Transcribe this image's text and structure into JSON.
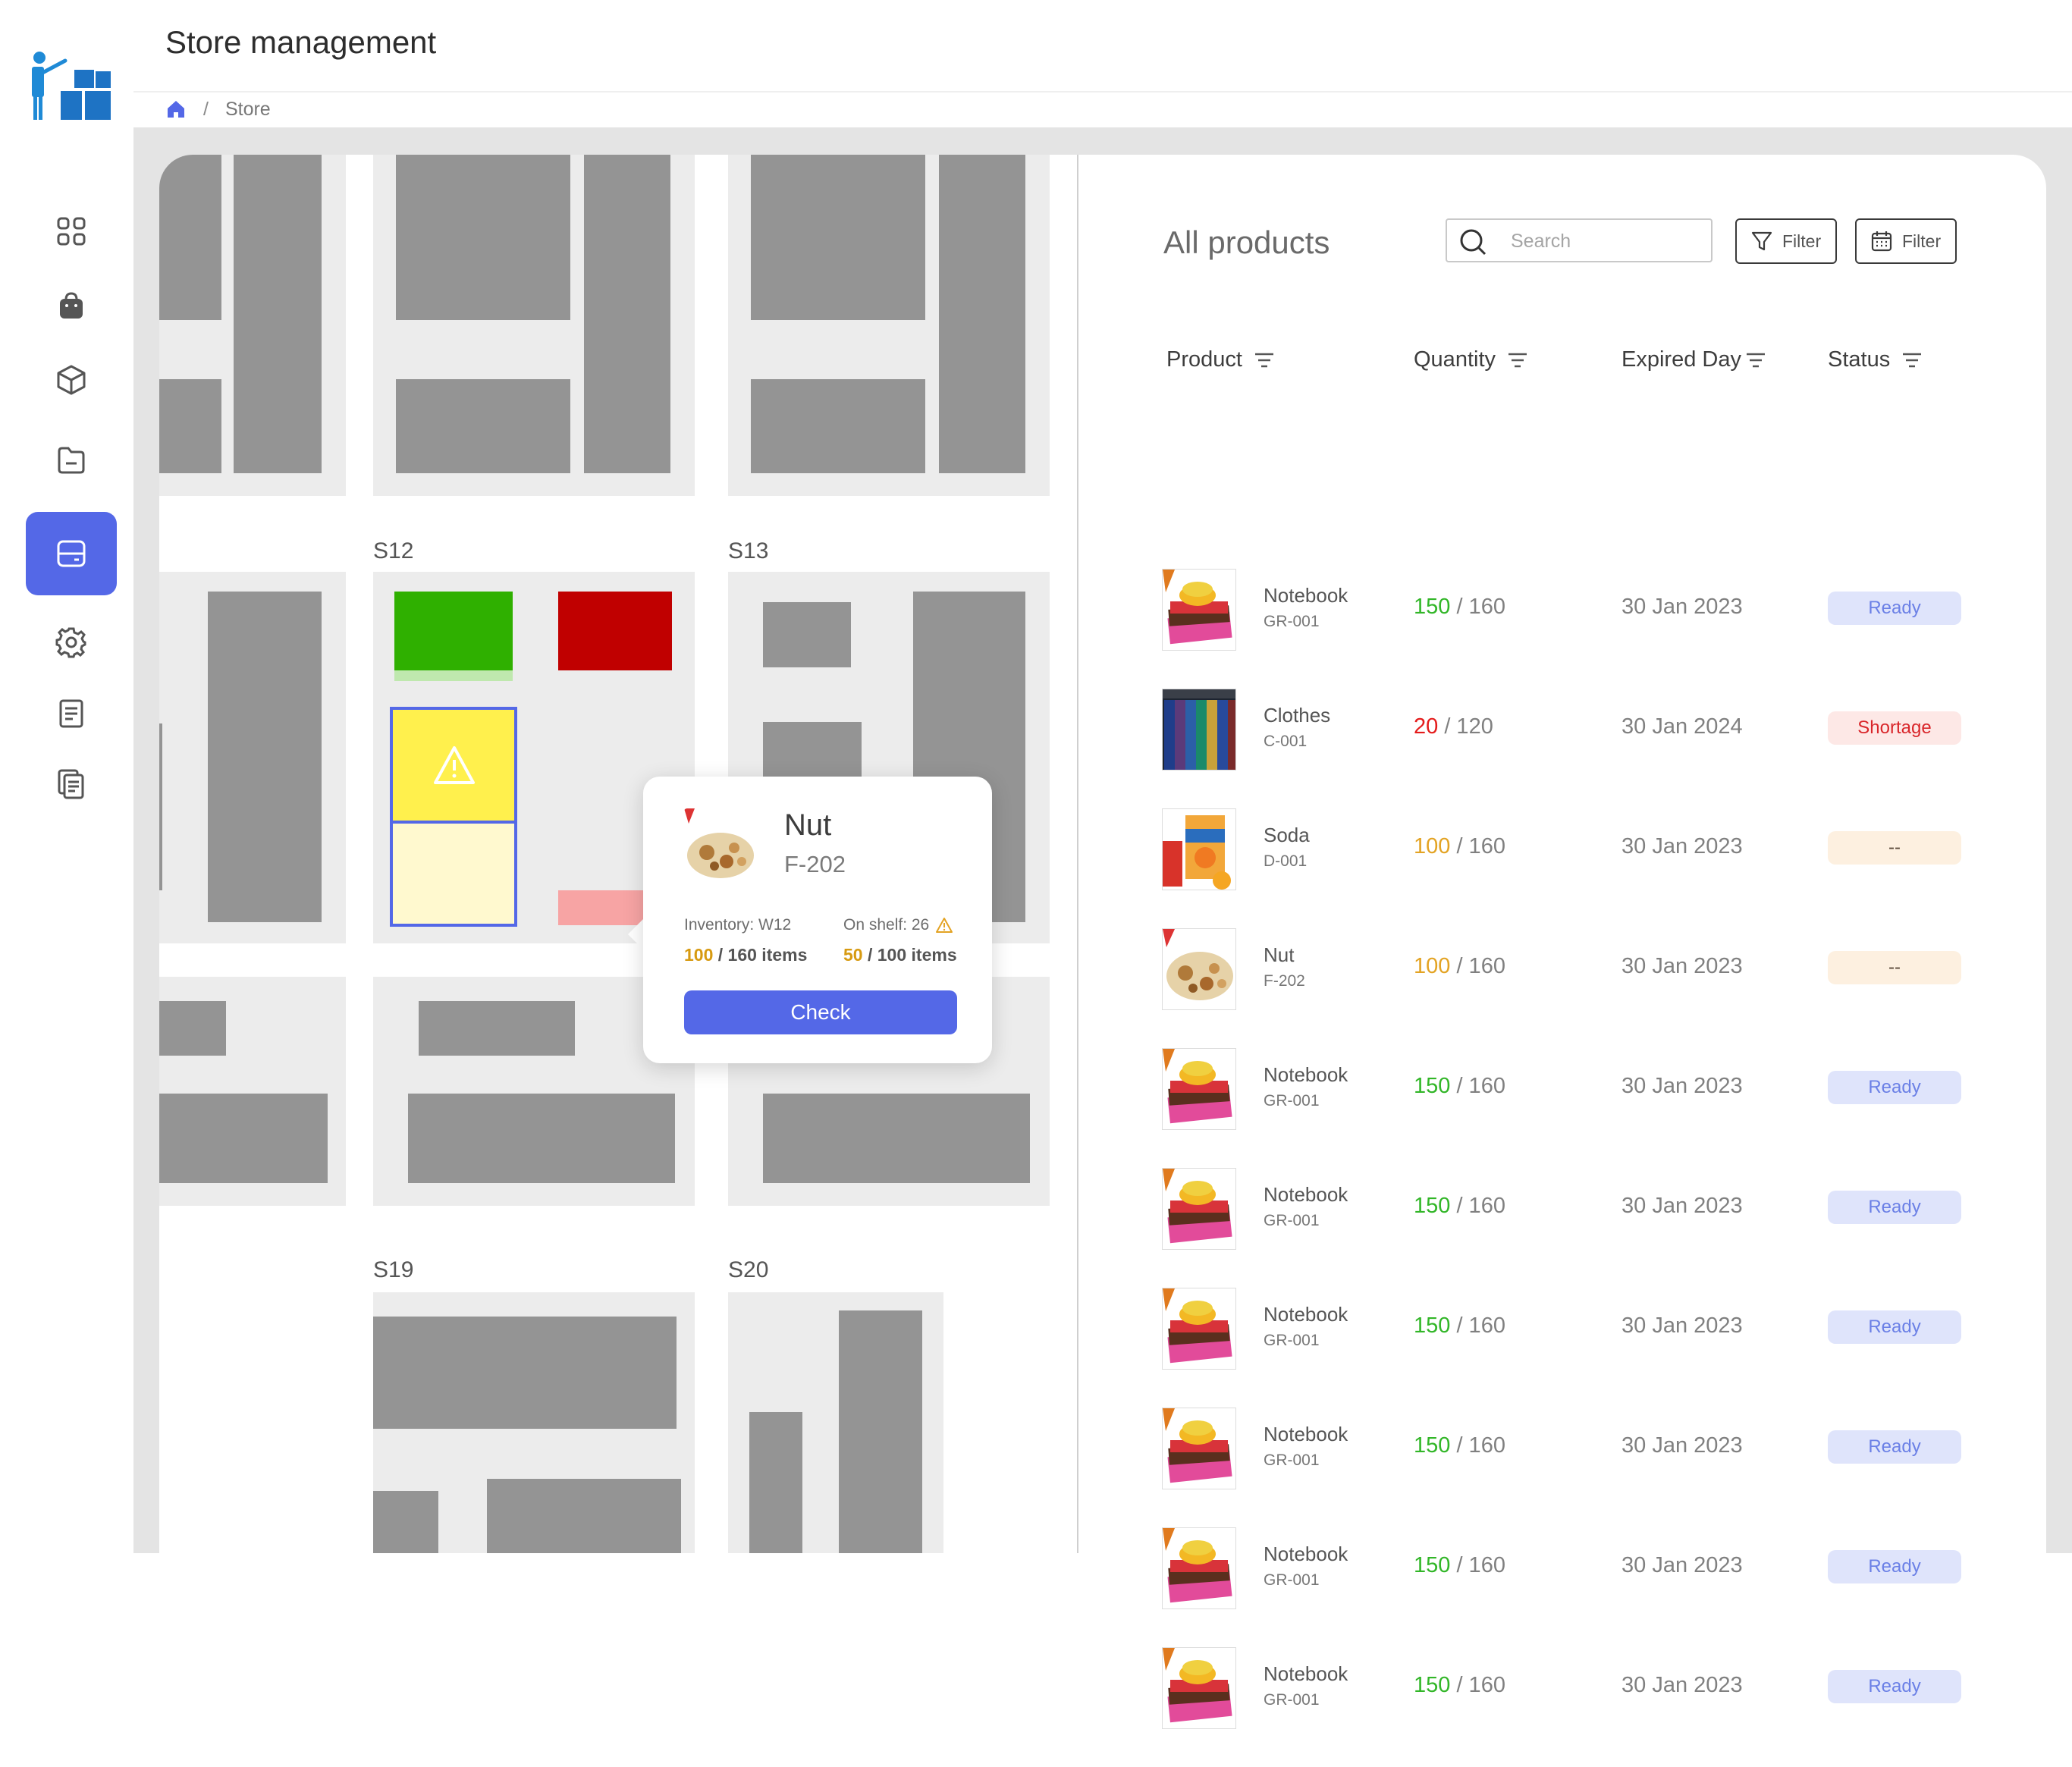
{
  "app": {
    "title": "Store management"
  },
  "breadcrumb": {
    "current": "Store"
  },
  "sidebar": {
    "items": [
      {
        "name": "dashboard",
        "icon": "grid-icon"
      },
      {
        "name": "orders",
        "icon": "shopping-bag-icon"
      },
      {
        "name": "products",
        "icon": "box-icon"
      },
      {
        "name": "files",
        "icon": "folder-icon"
      },
      {
        "name": "store",
        "icon": "server-icon",
        "active": true
      },
      {
        "name": "settings",
        "icon": "gear-icon"
      },
      {
        "name": "reports",
        "icon": "document-icon"
      },
      {
        "name": "documents",
        "icon": "copy-document-icon"
      }
    ]
  },
  "map": {
    "zones": [
      "S12",
      "S13",
      "S19",
      "S20"
    ],
    "colors": {
      "ok": "#2fb000",
      "critical": "#c00000",
      "warning": "#fff04d",
      "warning_light": "#fff9cf",
      "selected_border": "#5468e7",
      "low": "#f7a4a4"
    }
  },
  "popup": {
    "name": "Nut",
    "code": "F-202",
    "inventory_label": "Inventory: W12",
    "inventory_current": "100",
    "inventory_total": " / 160 items",
    "shelf_label": "On shelf: 26",
    "shelf_current": "50",
    "shelf_total": " / 100 items",
    "button": "Check"
  },
  "products": {
    "title": "All products",
    "search_placeholder": "Search",
    "filter1": "Filter",
    "filter2": "Filter",
    "columns": [
      "Product",
      "Quantity",
      "Expired Day",
      "Status"
    ],
    "rows": [
      {
        "name": "Notebook",
        "code": "GR-001",
        "qty": "150",
        "total": " / 160",
        "qtyColor": "green",
        "expired": "30 Jan 2023",
        "status": "Ready",
        "statusType": "ready",
        "thumb": "notebook"
      },
      {
        "name": "Clothes",
        "code": "C-001",
        "qty": "20",
        "total": " / 120",
        "qtyColor": "red",
        "expired": "30 Jan 2024",
        "status": "Shortage",
        "statusType": "shortage",
        "thumb": "clothes"
      },
      {
        "name": "Soda",
        "code": "D-001",
        "qty": "100",
        "total": " / 160",
        "qtyColor": "orange",
        "expired": "30 Jan 2023",
        "status": "--",
        "statusType": "pending",
        "thumb": "soda"
      },
      {
        "name": "Nut",
        "code": "F-202",
        "qty": "100",
        "total": " / 160",
        "qtyColor": "orange",
        "expired": "30 Jan 2023",
        "status": "--",
        "statusType": "pending",
        "thumb": "nut"
      },
      {
        "name": "Notebook",
        "code": "GR-001",
        "qty": "150",
        "total": " / 160",
        "qtyColor": "green",
        "expired": "30 Jan 2023",
        "status": "Ready",
        "statusType": "ready",
        "thumb": "notebook"
      },
      {
        "name": "Notebook",
        "code": "GR-001",
        "qty": "150",
        "total": " / 160",
        "qtyColor": "green",
        "expired": "30 Jan 2023",
        "status": "Ready",
        "statusType": "ready",
        "thumb": "notebook"
      },
      {
        "name": "Notebook",
        "code": "GR-001",
        "qty": "150",
        "total": " / 160",
        "qtyColor": "green",
        "expired": "30 Jan 2023",
        "status": "Ready",
        "statusType": "ready",
        "thumb": "notebook"
      },
      {
        "name": "Notebook",
        "code": "GR-001",
        "qty": "150",
        "total": " / 160",
        "qtyColor": "green",
        "expired": "30 Jan 2023",
        "status": "Ready",
        "statusType": "ready",
        "thumb": "notebook"
      },
      {
        "name": "Notebook",
        "code": "GR-001",
        "qty": "150",
        "total": " / 160",
        "qtyColor": "green",
        "expired": "30 Jan 2023",
        "status": "Ready",
        "statusType": "ready",
        "thumb": "notebook"
      },
      {
        "name": "Notebook",
        "code": "GR-001",
        "qty": "150",
        "total": " / 160",
        "qtyColor": "green",
        "expired": "30 Jan 2023",
        "status": "Ready",
        "statusType": "ready",
        "thumb": "notebook"
      }
    ]
  }
}
